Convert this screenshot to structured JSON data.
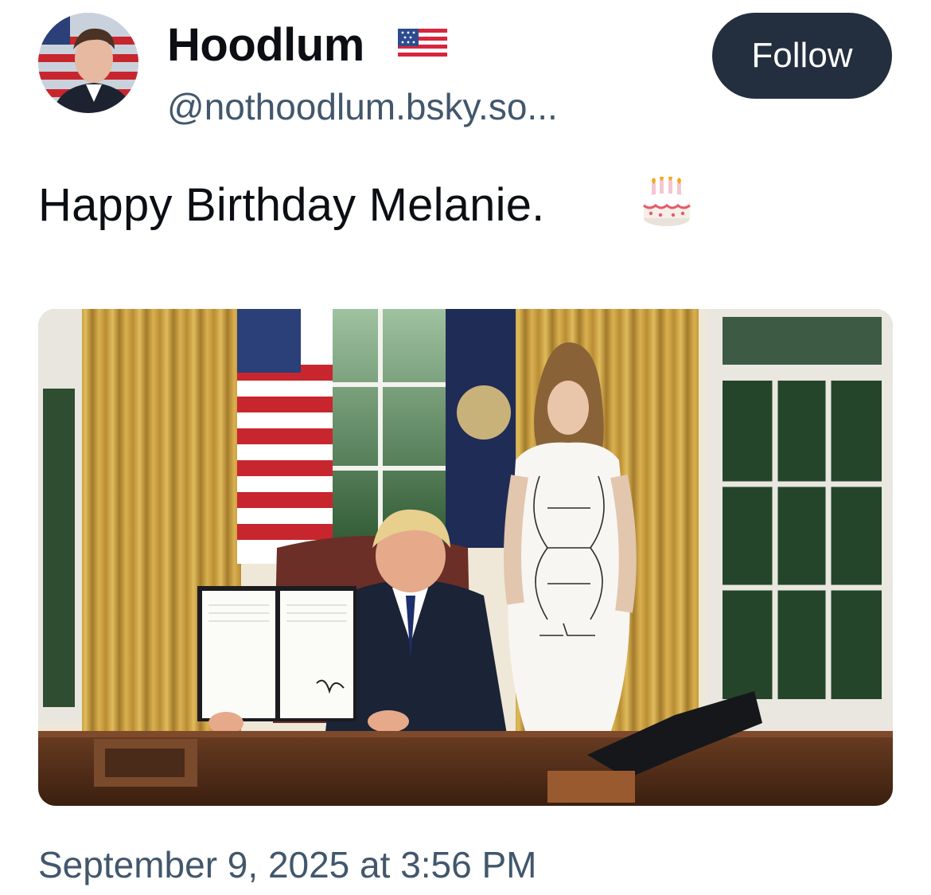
{
  "author": {
    "display_name": "Hoodlum",
    "handle": "@nothoodlum.bsky.so...",
    "avatar_icon": "profile-photo",
    "flag_icon": "us-flag-emoji"
  },
  "follow_button": {
    "label": "Follow",
    "bg": "#232e3e",
    "fg": "#ffffff"
  },
  "post": {
    "text": "Happy Birthday Melanie.",
    "emoji_icon": "birthday-cake-emoji",
    "image_alt": "Photo in the Oval Office: a man seated at a desk holding up a signed document, a woman in a white dress standing beside him, flags and gold curtains behind"
  },
  "timestamp": "September 9, 2025 at 3:56 PM",
  "colors": {
    "text": "#0b0f14",
    "muted": "#42576c"
  }
}
